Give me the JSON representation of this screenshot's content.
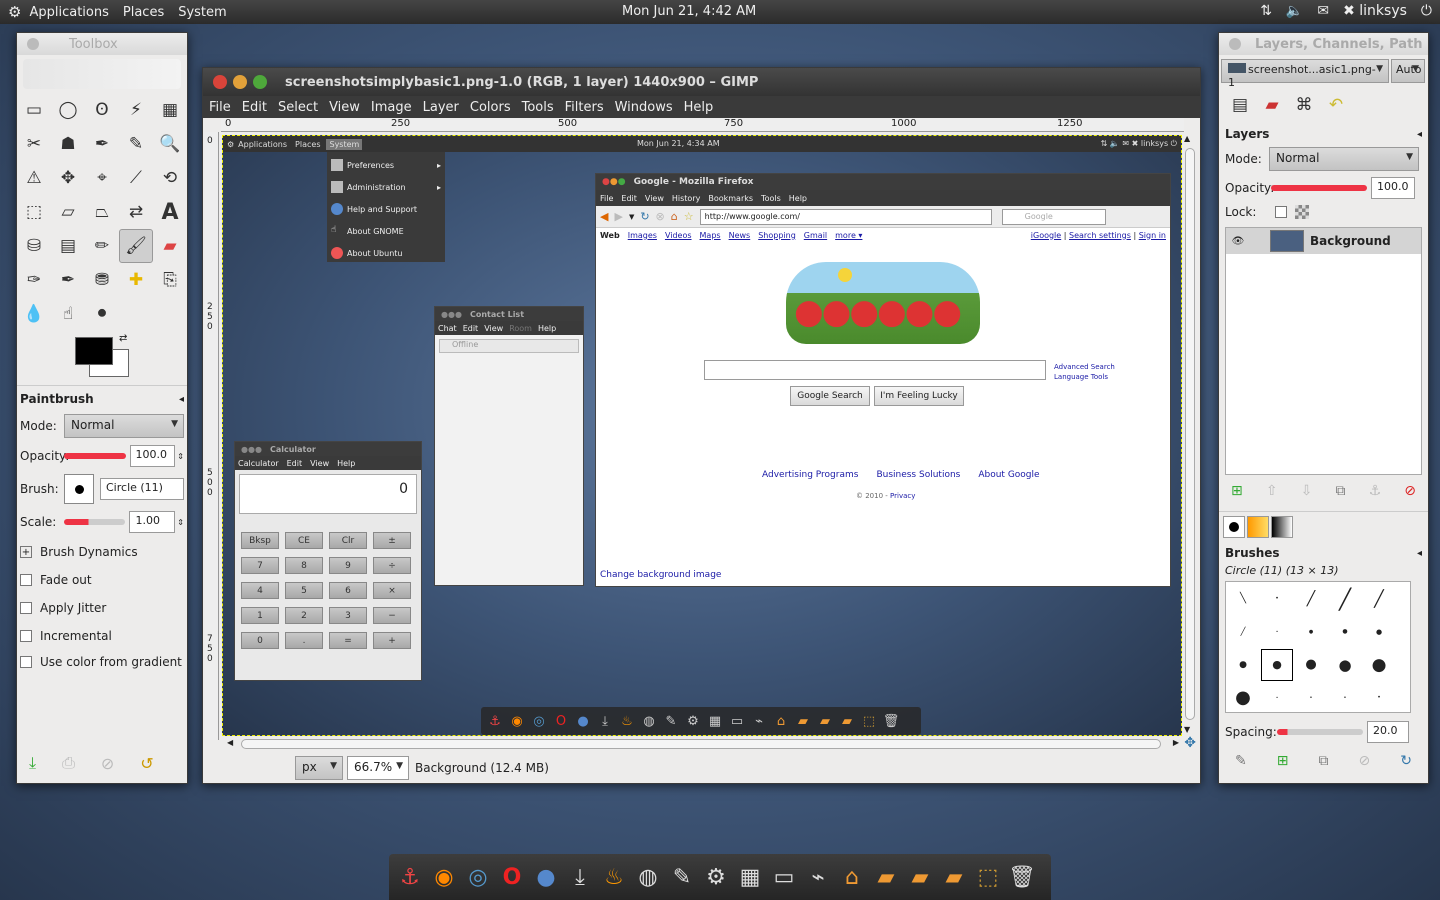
{
  "topbar": {
    "menu": [
      "Applications",
      "Places",
      "System"
    ],
    "clock": "Mon Jun 21,  4:42 AM",
    "user": "linksys"
  },
  "toolbox": {
    "title": "Toolbox",
    "options_title": "Paintbrush",
    "mode_label": "Mode:",
    "mode_value": "Normal",
    "opacity_label": "Opacity:",
    "opacity_value": "100.0",
    "opacity_percent": 100,
    "brush_label": "Brush:",
    "brush_value": "Circle (11)",
    "scale_label": "Scale:",
    "scale_value": "1.00",
    "brush_dynamics": "Brush Dynamics",
    "options": [
      "Fade out",
      "Apply Jitter",
      "Incremental",
      "Use color from gradient"
    ],
    "fg_color": "#000000",
    "bg_color": "#ffffff"
  },
  "gimp": {
    "title": "screenshotsimplybasic1.png-1.0 (RGB, 1 layer) 1440x900 – GIMP",
    "menu": [
      "File",
      "Edit",
      "Select",
      "View",
      "Image",
      "Layer",
      "Colors",
      "Tools",
      "Filters",
      "Windows",
      "Help"
    ],
    "ruler_h": [
      "0",
      "250",
      "500",
      "750",
      "1000",
      "1250"
    ],
    "ruler_v": [
      "0",
      "250",
      "500",
      "750"
    ],
    "unit": "px",
    "zoom": "66.7%",
    "status": "Background (12.4 MB)"
  },
  "canvas": {
    "topbar": {
      "menu": [
        "Applications",
        "Places",
        "System"
      ],
      "clock": "Mon Jun 21,  4:34 AM",
      "user": "linksys"
    },
    "system_menu": [
      "Preferences",
      "Administration",
      "Help and Support",
      "About GNOME",
      "About Ubuntu"
    ],
    "contact": {
      "title": "Contact List",
      "menu": [
        "Chat",
        "Edit",
        "View",
        "Room",
        "Help"
      ],
      "status": "Offline"
    },
    "calculator": {
      "title": "Calculator",
      "menu": [
        "Calculator",
        "Edit",
        "View",
        "Help"
      ],
      "display": "0",
      "buttons": [
        "Bksp",
        "CE",
        "Clr",
        "±",
        "7",
        "8",
        "9",
        "÷",
        "4",
        "5",
        "6",
        "×",
        "1",
        "2",
        "3",
        "−",
        "0",
        ".",
        "=",
        "+"
      ]
    },
    "firefox": {
      "title": "Google - Mozilla Firefox",
      "menu": [
        "File",
        "Edit",
        "View",
        "History",
        "Bookmarks",
        "Tools",
        "Help"
      ],
      "url": "http://www.google.com/",
      "search_placeholder": "Google",
      "nav_links": [
        "Web",
        "Images",
        "Videos",
        "Maps",
        "News",
        "Shopping",
        "Gmail",
        "more ▾"
      ],
      "right_links": [
        "iGoogle",
        "Search settings",
        "Sign in"
      ],
      "advanced": "Advanced Search",
      "language": "Language Tools",
      "btn_search": "Google Search",
      "btn_lucky": "I'm Feeling Lucky",
      "footer_links": [
        "Advertising Programs",
        "Business Solutions",
        "About Google"
      ],
      "copyright": "© 2010 -",
      "privacy": "Privacy",
      "change_bg": "Change background image"
    }
  },
  "layers": {
    "title": "Layers, Channels, Path",
    "image": "screenshot...asic1.png-1",
    "auto": "Auto",
    "section": "Layers",
    "mode_label": "Mode:",
    "mode_value": "Normal",
    "opacity_label": "Opacity:",
    "opacity_value": "100.0",
    "lock_label": "Lock:",
    "layer_name": "Background",
    "brushes_title": "Brushes",
    "brush_info": "Circle (11) (13 × 13)",
    "spacing_label": "Spacing:",
    "spacing_value": "20.0"
  }
}
